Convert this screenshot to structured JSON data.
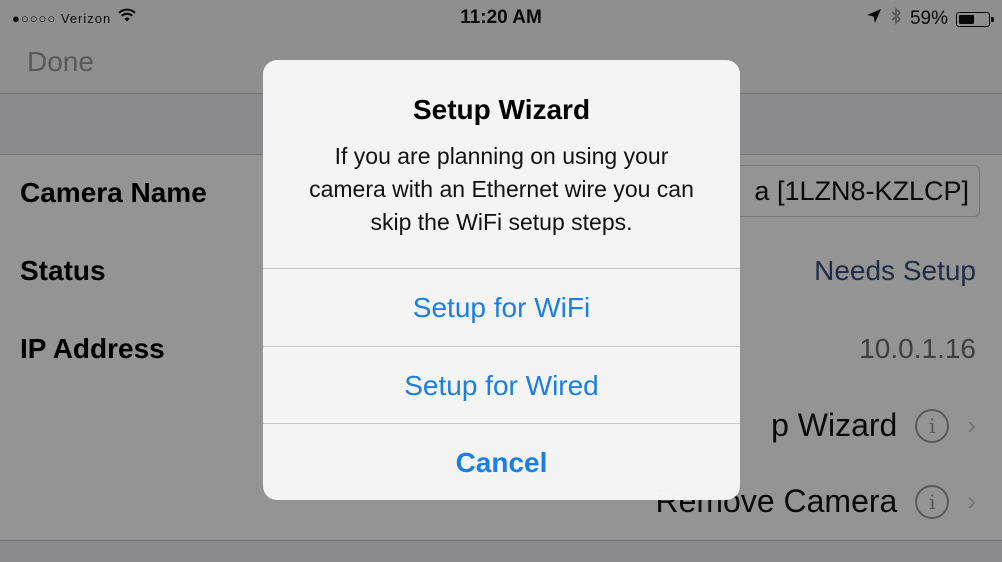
{
  "status_bar": {
    "carrier": "●○○○○ Verizon",
    "time": "11:20 AM",
    "battery_percent": "59%",
    "battery_level": 0.59,
    "icons": [
      "wifi-icon",
      "location-arrow-icon",
      "bluetooth-icon",
      "battery-icon"
    ]
  },
  "nav": {
    "done_label": "Done"
  },
  "rows": {
    "camera_name_label": "Camera Name",
    "camera_name_value": "a [1LZN8-KZLCP]",
    "status_label": "Status",
    "status_value": "Needs Setup",
    "ip_label": "IP Address",
    "ip_value": "10.0.1.16",
    "setup_wizard_label": "p Wizard",
    "remove_camera_label": "Remove Camera"
  },
  "alert": {
    "title": "Setup Wizard",
    "message": "If you are planning on using your camera with an Ethernet wire you can skip the WiFi setup steps.",
    "buttons": [
      "Setup for WiFi",
      "Setup for Wired",
      "Cancel"
    ]
  },
  "colors": {
    "accent": "#1a7ee6",
    "status_value": "#36507a",
    "secondary_text": "#6d6d72"
  }
}
